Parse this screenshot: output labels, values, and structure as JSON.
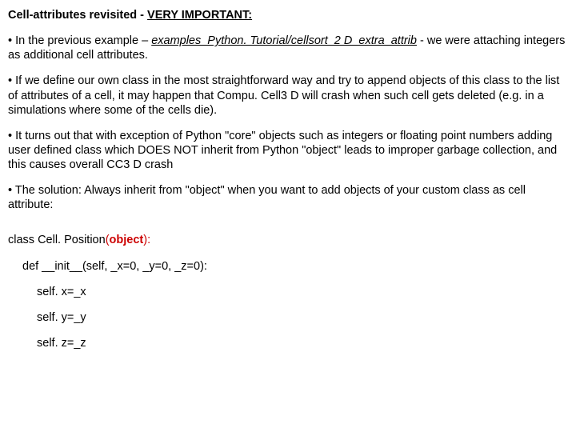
{
  "title": {
    "prefix": "Cell-attributes revisited - ",
    "emph": "VERY IMPORTANT:"
  },
  "bullets": {
    "b1": {
      "dot": "• ",
      "t1": "In the previous example – ",
      "path": "examples_Python. Tutorial/cellsort_2 D_extra_attrib",
      "t2": " - we were attaching integers as additional cell attributes."
    },
    "b2": {
      "dot": "• ",
      "t1": "If we define our own class in the most straightforward way and try to append objects of this class to the list of attributes of a cell, it may happen that Compu. Cell3 D will crash when such cell gets deleted (e.g. in a simulations where some of the cells die)."
    },
    "b3": {
      "dot": "• ",
      "t1": "It turns out that with exception of Python \"core\" objects such as integers or floating point numbers adding user defined class which DOES NOT inherit from Python \"object\" leads to improper garbage collection, and this causes overall CC3 D crash"
    },
    "b4": {
      "dot": "• ",
      "t1": "The solution: Always inherit from \"object\" when you want to add objects of your custom class as cell attribute:"
    }
  },
  "code": {
    "line1a": "class Cell. Position",
    "line1b": "(",
    "line1c": "object",
    "line1d": "):",
    "line2": "def __init__(self, _x=0, _y=0, _z=0):",
    "line3": "self. x=_x",
    "line4": "self. y=_y",
    "line5": "self. z=_z"
  }
}
